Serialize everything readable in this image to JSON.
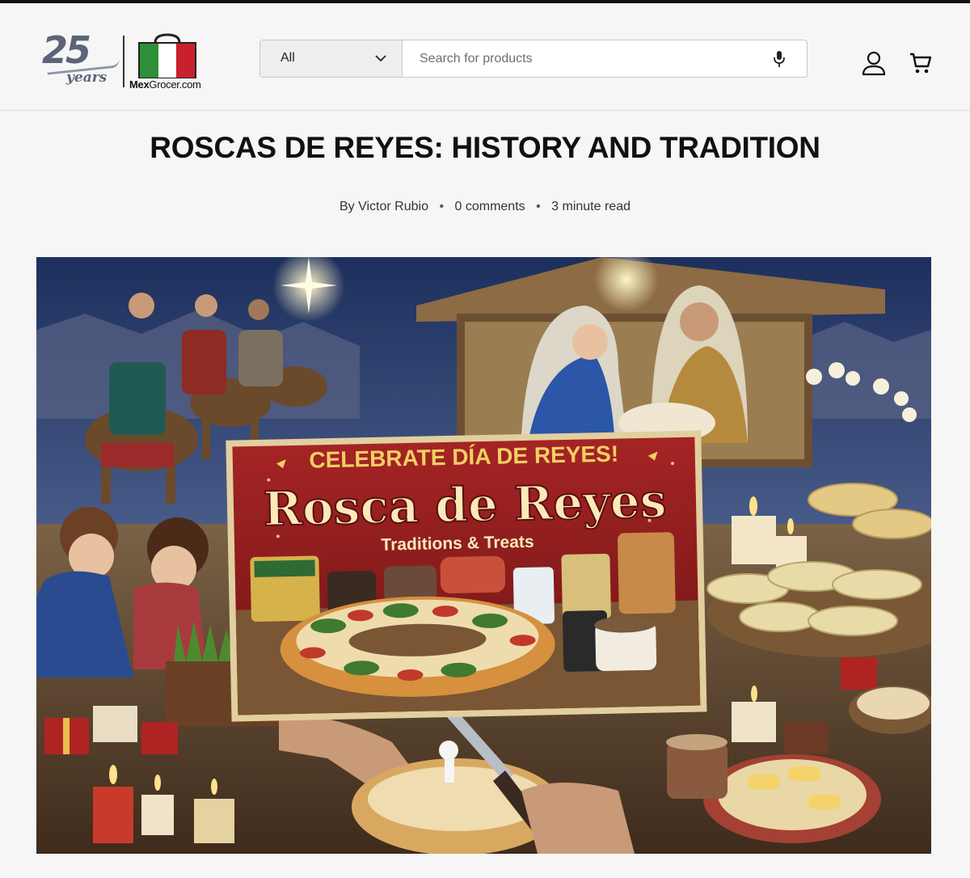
{
  "header": {
    "logo": {
      "anniversary_number": "25",
      "anniversary_word": "years",
      "brand_bold": "Mex",
      "brand_rest": "Grocer.com"
    },
    "search": {
      "category": "All",
      "placeholder": "Search for products"
    },
    "icons": [
      "chevron-down-icon",
      "microphone-icon",
      "account-icon",
      "cart-icon"
    ]
  },
  "article": {
    "title": "ROSCAS DE REYES: HISTORY AND TRADITION",
    "meta": {
      "author": "By Victor Rubio",
      "comments": "0 comments",
      "read_time": "3 minute read"
    },
    "hero": {
      "headline": "CELEBRATE DÍA DE REYES!",
      "title": "Rosca de Reyes",
      "subtitle": "Traditions & Treats"
    }
  },
  "colors": {
    "page_bg": "#f6f6f6",
    "banner_red": "#8e1c1c",
    "banner_gold": "#f2cf63",
    "flag_green": "#2f8f3a",
    "flag_red": "#c8202c"
  }
}
